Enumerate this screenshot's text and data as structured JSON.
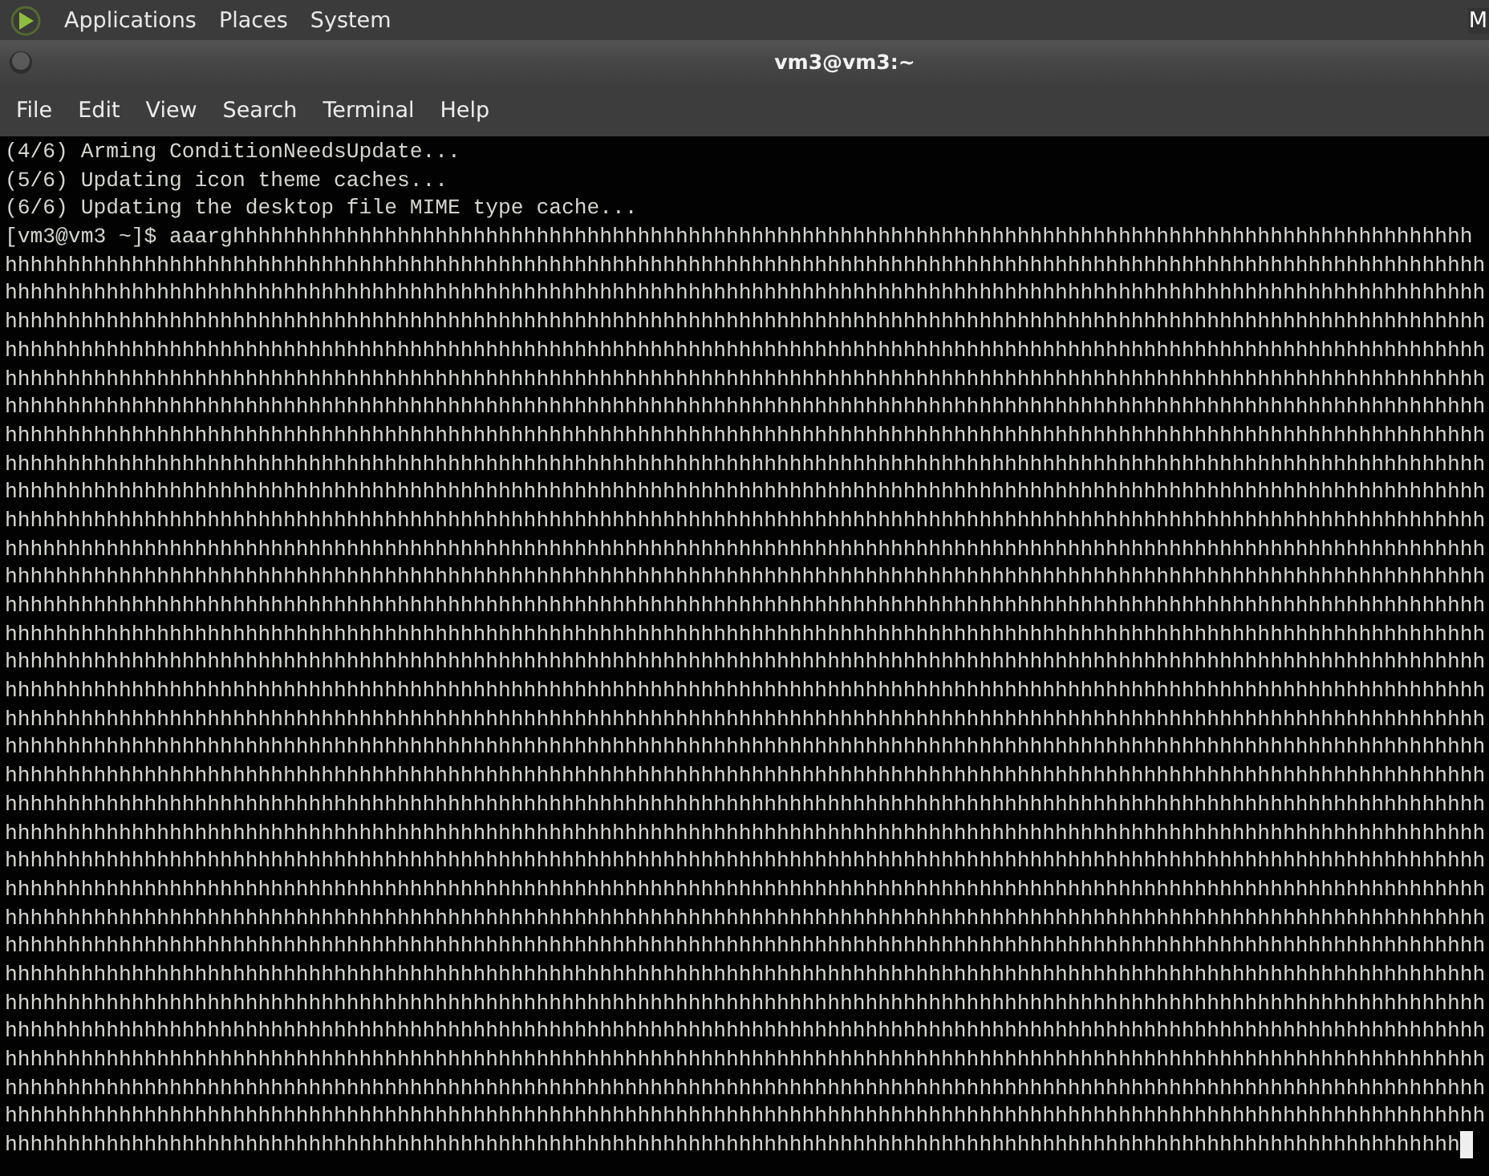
{
  "top_panel": {
    "menus": [
      "Applications",
      "Places",
      "System"
    ],
    "right_label": "M"
  },
  "window": {
    "title": "vm3@vm3:~"
  },
  "menu_bar": [
    "File",
    "Edit",
    "View",
    "Search",
    "Terminal",
    "Help"
  ],
  "terminal": {
    "lines": [
      "(4/6) Arming ConditionNeedsUpdate...",
      "(5/6) Updating icon theme caches...",
      "(6/6) Updating the desktop file MIME type cache...",
      "[vm3@vm3 ~]$ aaarghhhhhhhhhhhhhhhhhhhhhhhhhhhhhhhhhhhhhhhhhhhhhhhhhhhhhhhhhhhhhhhhhhhhhhhhhhhhhhhhhhhhhhhhhhhhhhhhhh",
      "hhhhhhhhhhhhhhhhhhhhhhhhhhhhhhhhhhhhhhhhhhhhhhhhhhhhhhhhhhhhhhhhhhhhhhhhhhhhhhhhhhhhhhhhhhhhhhhhhhhhhhhhhhhhhhhhhhhhh",
      "hhhhhhhhhhhhhhhhhhhhhhhhhhhhhhhhhhhhhhhhhhhhhhhhhhhhhhhhhhhhhhhhhhhhhhhhhhhhhhhhhhhhhhhhhhhhhhhhhhhhhhhhhhhhhhhhhhhhh",
      "hhhhhhhhhhhhhhhhhhhhhhhhhhhhhhhhhhhhhhhhhhhhhhhhhhhhhhhhhhhhhhhhhhhhhhhhhhhhhhhhhhhhhhhhhhhhhhhhhhhhhhhhhhhhhhhhhhhhh",
      "hhhhhhhhhhhhhhhhhhhhhhhhhhhhhhhhhhhhhhhhhhhhhhhhhhhhhhhhhhhhhhhhhhhhhhhhhhhhhhhhhhhhhhhhhhhhhhhhhhhhhhhhhhhhhhhhhhhhh",
      "hhhhhhhhhhhhhhhhhhhhhhhhhhhhhhhhhhhhhhhhhhhhhhhhhhhhhhhhhhhhhhhhhhhhhhhhhhhhhhhhhhhhhhhhhhhhhhhhhhhhhhhhhhhhhhhhhhhhh",
      "hhhhhhhhhhhhhhhhhhhhhhhhhhhhhhhhhhhhhhhhhhhhhhhhhhhhhhhhhhhhhhhhhhhhhhhhhhhhhhhhhhhhhhhhhhhhhhhhhhhhhhhhhhhhhhhhhhhhh",
      "hhhhhhhhhhhhhhhhhhhhhhhhhhhhhhhhhhhhhhhhhhhhhhhhhhhhhhhhhhhhhhhhhhhhhhhhhhhhhhhhhhhhhhhhhhhhhhhhhhhhhhhhhhhhhhhhhhhhh",
      "hhhhhhhhhhhhhhhhhhhhhhhhhhhhhhhhhhhhhhhhhhhhhhhhhhhhhhhhhhhhhhhhhhhhhhhhhhhhhhhhhhhhhhhhhhhhhhhhhhhhhhhhhhhhhhhhhhhhh",
      "hhhhhhhhhhhhhhhhhhhhhhhhhhhhhhhhhhhhhhhhhhhhhhhhhhhhhhhhhhhhhhhhhhhhhhhhhhhhhhhhhhhhhhhhhhhhhhhhhhhhhhhhhhhhhhhhhhhhh",
      "hhhhhhhhhhhhhhhhhhhhhhhhhhhhhhhhhhhhhhhhhhhhhhhhhhhhhhhhhhhhhhhhhhhhhhhhhhhhhhhhhhhhhhhhhhhhhhhhhhhhhhhhhhhhhhhhhhhhh",
      "hhhhhhhhhhhhhhhhhhhhhhhhhhhhhhhhhhhhhhhhhhhhhhhhhhhhhhhhhhhhhhhhhhhhhhhhhhhhhhhhhhhhhhhhhhhhhhhhhhhhhhhhhhhhhhhhhhhhh",
      "hhhhhhhhhhhhhhhhhhhhhhhhhhhhhhhhhhhhhhhhhhhhhhhhhhhhhhhhhhhhhhhhhhhhhhhhhhhhhhhhhhhhhhhhhhhhhhhhhhhhhhhhhhhhhhhhhhhhh",
      "hhhhhhhhhhhhhhhhhhhhhhhhhhhhhhhhhhhhhhhhhhhhhhhhhhhhhhhhhhhhhhhhhhhhhhhhhhhhhhhhhhhhhhhhhhhhhhhhhhhhhhhhhhhhhhhhhhhhh",
      "hhhhhhhhhhhhhhhhhhhhhhhhhhhhhhhhhhhhhhhhhhhhhhhhhhhhhhhhhhhhhhhhhhhhhhhhhhhhhhhhhhhhhhhhhhhhhhhhhhhhhhhhhhhhhhhhhhhhh",
      "hhhhhhhhhhhhhhhhhhhhhhhhhhhhhhhhhhhhhhhhhhhhhhhhhhhhhhhhhhhhhhhhhhhhhhhhhhhhhhhhhhhhhhhhhhhhhhhhhhhhhhhhhhhhhhhhhhhhh",
      "hhhhhhhhhhhhhhhhhhhhhhhhhhhhhhhhhhhhhhhhhhhhhhhhhhhhhhhhhhhhhhhhhhhhhhhhhhhhhhhhhhhhhhhhhhhhhhhhhhhhhhhhhhhhhhhhhhhhh",
      "hhhhhhhhhhhhhhhhhhhhhhhhhhhhhhhhhhhhhhhhhhhhhhhhhhhhhhhhhhhhhhhhhhhhhhhhhhhhhhhhhhhhhhhhhhhhhhhhhhhhhhhhhhhhhhhhhhhhh",
      "hhhhhhhhhhhhhhhhhhhhhhhhhhhhhhhhhhhhhhhhhhhhhhhhhhhhhhhhhhhhhhhhhhhhhhhhhhhhhhhhhhhhhhhhhhhhhhhhhhhhhhhhhhhhhhhhhhhhh",
      "hhhhhhhhhhhhhhhhhhhhhhhhhhhhhhhhhhhhhhhhhhhhhhhhhhhhhhhhhhhhhhhhhhhhhhhhhhhhhhhhhhhhhhhhhhhhhhhhhhhhhhhhhhhhhhhhhhhhh",
      "hhhhhhhhhhhhhhhhhhhhhhhhhhhhhhhhhhhhhhhhhhhhhhhhhhhhhhhhhhhhhhhhhhhhhhhhhhhhhhhhhhhhhhhhhhhhhhhhhhhhhhhhhhhhhhhhhhhhh",
      "hhhhhhhhhhhhhhhhhhhhhhhhhhhhhhhhhhhhhhhhhhhhhhhhhhhhhhhhhhhhhhhhhhhhhhhhhhhhhhhhhhhhhhhhhhhhhhhhhhhhhhhhhhhhhhhhhhhhh",
      "hhhhhhhhhhhhhhhhhhhhhhhhhhhhhhhhhhhhhhhhhhhhhhhhhhhhhhhhhhhhhhhhhhhhhhhhhhhhhhhhhhhhhhhhhhhhhhhhhhhhhhhhhhhhhhhhhhhhh",
      "hhhhhhhhhhhhhhhhhhhhhhhhhhhhhhhhhhhhhhhhhhhhhhhhhhhhhhhhhhhhhhhhhhhhhhhhhhhhhhhhhhhhhhhhhhhhhhhhhhhhhhhhhhhhhhhhhhhhh",
      "hhhhhhhhhhhhhhhhhhhhhhhhhhhhhhhhhhhhhhhhhhhhhhhhhhhhhhhhhhhhhhhhhhhhhhhhhhhhhhhhhhhhhhhhhhhhhhhhhhhhhhhhhhhhhhhhhhhhh",
      "hhhhhhhhhhhhhhhhhhhhhhhhhhhhhhhhhhhhhhhhhhhhhhhhhhhhhhhhhhhhhhhhhhhhhhhhhhhhhhhhhhhhhhhhhhhhhhhhhhhhhhhhhhhhhhhhhhhhh",
      "hhhhhhhhhhhhhhhhhhhhhhhhhhhhhhhhhhhhhhhhhhhhhhhhhhhhhhhhhhhhhhhhhhhhhhhhhhhhhhhhhhhhhhhhhhhhhhhhhhhhhhhhhhhhhhhhhhhhh",
      "hhhhhhhhhhhhhhhhhhhhhhhhhhhhhhhhhhhhhhhhhhhhhhhhhhhhhhhhhhhhhhhhhhhhhhhhhhhhhhhhhhhhhhhhhhhhhhhhhhhhhhhhhhhhhhhhhhhhh",
      "hhhhhhhhhhhhhhhhhhhhhhhhhhhhhhhhhhhhhhhhhhhhhhhhhhhhhhhhhhhhhhhhhhhhhhhhhhhhhhhhhhhhhhhhhhhhhhhhhhhhhhhhhhhhhhhhhhhhh",
      "hhhhhhhhhhhhhhhhhhhhhhhhhhhhhhhhhhhhhhhhhhhhhhhhhhhhhhhhhhhhhhhhhhhhhhhhhhhhhhhhhhhhhhhhhhhhhhhhhhhhhhhhhhhhhhhhhhhhh",
      "hhhhhhhhhhhhhhhhhhhhhhhhhhhhhhhhhhhhhhhhhhhhhhhhhhhhhhhhhhhhhhhhhhhhhhhhhhhhhhhhhhhhhhhhhhhhhhhhhhhhhhhhhhhhhhhhhhhhh",
      "hhhhhhhhhhhhhhhhhhhhhhhhhhhhhhhhhhhhhhhhhhhhhhhhhhhhhhhhhhhhhhhhhhhhhhhhhhhhhhhhhhhhhhhhhhhhhhhhhhhhhhhhhhhhhhhhhhhhh",
      "hhhhhhhhhhhhhhhhhhhhhhhhhhhhhhhhhhhhhhhhhhhhhhhhhhhhhhhhhhhhhhhhhhhhhhhhhhhhhhhhhhhhhhhhhhhhhhhhhhhhhhhhhhhhhhhhhhh"
    ]
  }
}
